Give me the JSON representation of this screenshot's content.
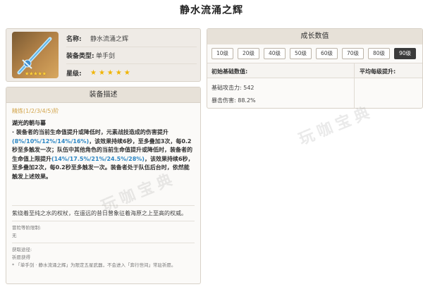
{
  "title": "静水流涌之辉",
  "info": {
    "name_key": "名称:",
    "name_val": "静水流涌之辉",
    "type_key": "装备类型:",
    "type_val": "单手剑",
    "rank_key": "星级:",
    "rank_stars": "★★★★★",
    "image_stars": "★★★★★"
  },
  "description": {
    "header": "装备描述",
    "refine": "精炼(1/2/3/4/5)阶",
    "subtitle": "湖光的朝与暮",
    "p1_a": "· 装备者的当前生命值提升或降低时，元素战技造成的伤害提升",
    "p1_b": "(8%/10%/12%/14%/16%)",
    "p1_c": "，该效果持续6秒，至多叠加3次，每0.2秒至多触发一次；队伍中其他角色的当前生命值提升或降低时，装备者的生命值上限提升",
    "p1_d": "(14%/17.5%/21%/24.5%/28%)",
    "p1_e": "，该效果持续6秒，至多叠加2次，每0.2秒至多触发一次。装备者处于队伍后台时，依然能触发上述效果。",
    "flavor": "紫绕着至纯之水的权杖，在遥远的昔日曾象征着海原之上至高的权威。",
    "ascend_label": "冒险等阶限制:",
    "ascend_val": "无",
    "source_label": "获取途径:",
    "source_val": "祈愿获得",
    "note": "* 「单手剑 · 静水流涌之辉」为限定五星武器，不会进入「奔行世间」常驻祈愿。"
  },
  "growth": {
    "header": "成长数值",
    "levels": [
      "10级",
      "20级",
      "40级",
      "50级",
      "60级",
      "70级",
      "80级",
      "90级"
    ],
    "active_level": "90级",
    "col1_header": "初始基础数值:",
    "col2_header": "平均每级提升:",
    "base_atk": "基础攻击力: 542",
    "crit_dmg": "暴击伤害: 88.2%"
  },
  "watermark": "玩咖宝典",
  "icons": {
    "weapon": "sword-image-icon"
  }
}
